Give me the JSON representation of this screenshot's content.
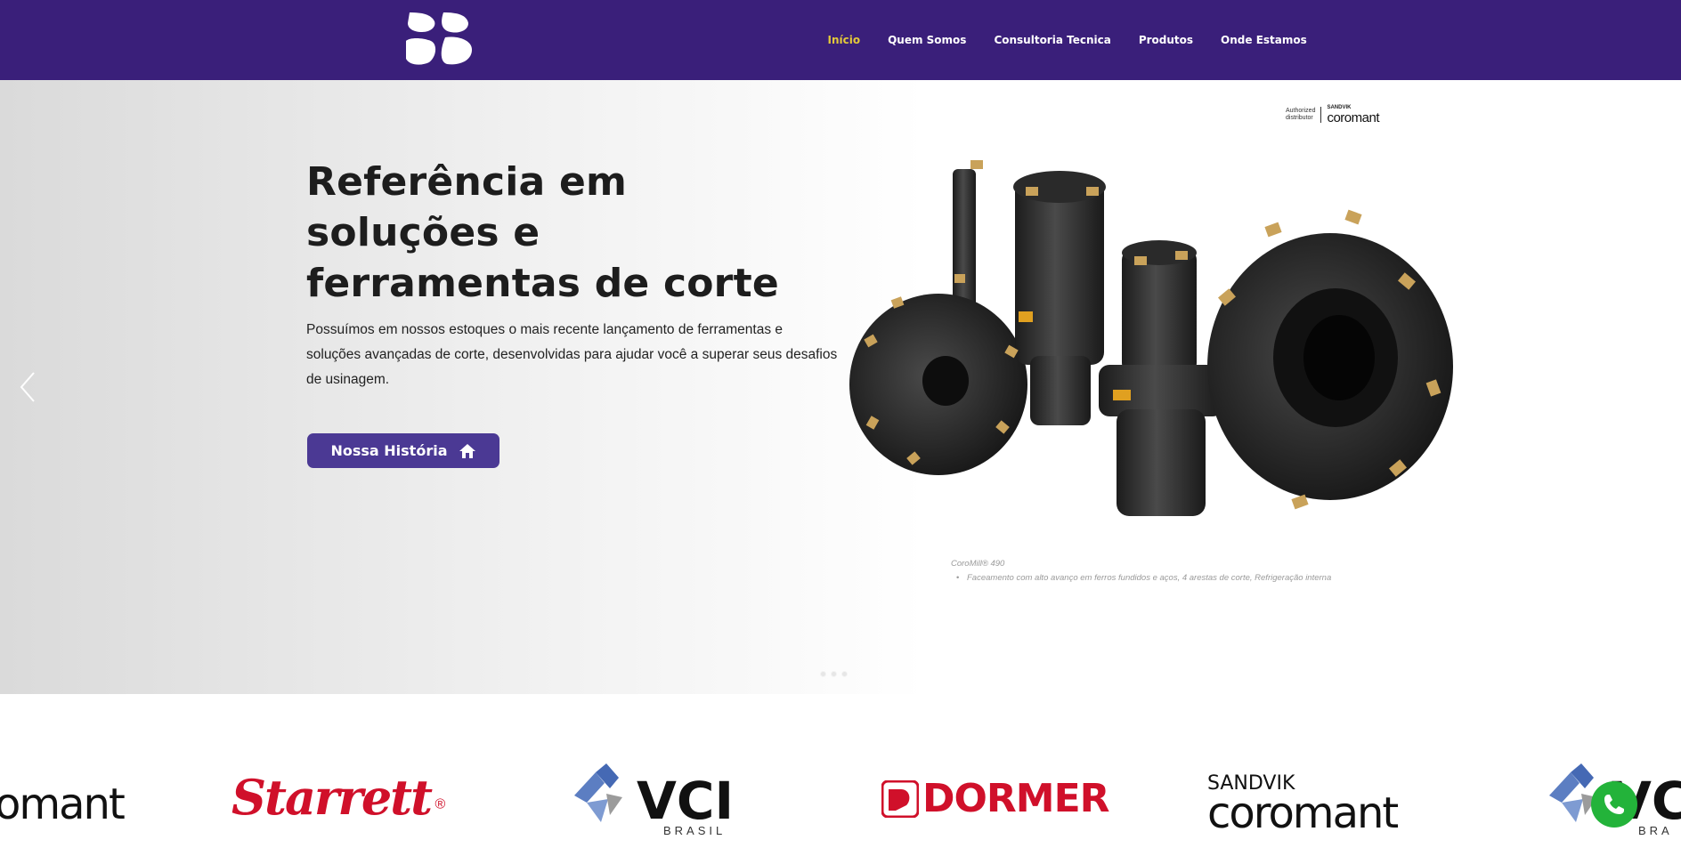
{
  "header": {
    "logo_icon": "company-logo",
    "nav": [
      {
        "label": "Início",
        "active": true
      },
      {
        "label": "Quem Somos",
        "active": false
      },
      {
        "label": "Consultoria Tecnica",
        "active": false
      },
      {
        "label": "Produtos",
        "active": false
      },
      {
        "label": "Onde Estamos",
        "active": false
      }
    ],
    "colors": {
      "background": "#3a1f7a",
      "active": "#e3c93a",
      "text": "#ffffff"
    }
  },
  "hero": {
    "title": "Referência em soluções e ferramentas de corte",
    "text": "Possuímos em nossos estoques o mais recente lançamento de ferramentas e soluções avançadas de corte, desenvolvidas para ajudar você a superar seus desafios de usinagem.",
    "cta_label": "Nossa História",
    "cta_icon": "home-icon",
    "authorized": {
      "line1": "Authorized",
      "line2": "distributor",
      "brand_small": "SANDVIK",
      "brand_large": "coromant"
    },
    "caption_title": "CoroMill® 490",
    "caption_item": "Faceamento com alto avanço em ferros fundidos e aços, 4 arestas de corte, Refrigeração interna",
    "slides_count": 3,
    "accent": "#4b3994"
  },
  "brands": [
    {
      "name": "coromant (partial)",
      "text": "omant"
    },
    {
      "name": "Starrett",
      "text": "Starrett",
      "mark": "®"
    },
    {
      "name": "VCI Brasil",
      "text": "VCI",
      "sub": "BRASIL"
    },
    {
      "name": "Dormer",
      "text": "DORMER"
    },
    {
      "name": "Sandvik Coromant",
      "top": "SANDVIK",
      "text": "coromant"
    },
    {
      "name": "VCI (partial)",
      "text": "VC",
      "sub": "BRA"
    }
  ],
  "floating": {
    "whatsapp_icon": "whatsapp-icon"
  }
}
